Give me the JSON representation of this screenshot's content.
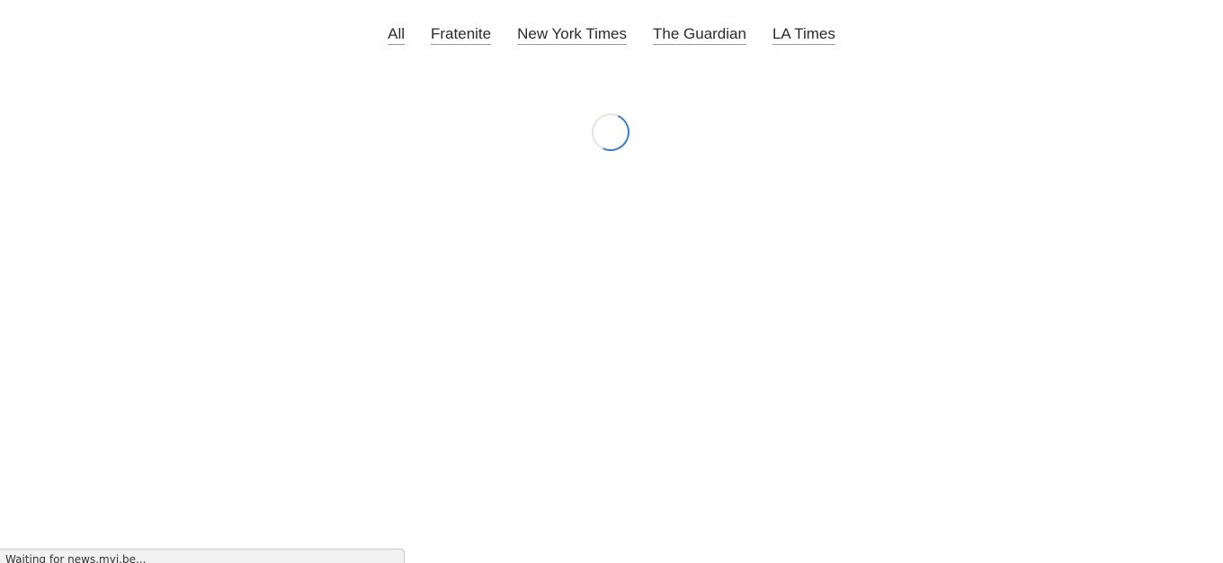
{
  "nav": {
    "items": [
      {
        "label": "All"
      },
      {
        "label": "Fratenite"
      },
      {
        "label": "New York Times"
      },
      {
        "label": "The Guardian"
      },
      {
        "label": "LA Times"
      }
    ]
  },
  "loader": {
    "icon": "loading-spinner-icon",
    "accent_color": "#3a7bc8",
    "track_color": "#e3e3e3"
  },
  "status_bar": {
    "text": "Waiting for news.myi.be..."
  }
}
